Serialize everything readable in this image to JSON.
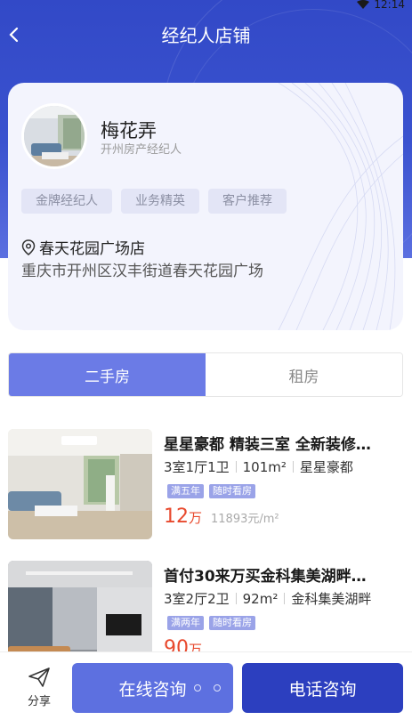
{
  "status_bar": {
    "time": "12:14"
  },
  "nav": {
    "title": "经纪人店铺"
  },
  "agent": {
    "name": "梅花弄",
    "title": "开州房产经纪人",
    "tags": [
      "金牌经纪人",
      "业务精英",
      "客户推荐"
    ],
    "store_name": "春天花园广场店",
    "store_address": "重庆市开州区汉丰街道春天花园广场"
  },
  "tabs": [
    {
      "label": "二手房",
      "active": true
    },
    {
      "label": "租房",
      "active": false
    }
  ],
  "listings": [
    {
      "title": "星星豪都 精装三室 全新装修…",
      "layout": "3室1厅1卫",
      "area": "101m²",
      "community": "星星豪都",
      "badges": [
        "满五年",
        "随时看房"
      ],
      "price": "12",
      "price_unit": "万",
      "unit_price": "11893元/m²"
    },
    {
      "title": "首付30来万买金科集美湖畔…",
      "layout": "3室2厅2卫",
      "area": "92m²",
      "community": "金科集美湖畔",
      "badges": [
        "满两年",
        "随时看房"
      ],
      "price": "90",
      "price_unit": "万",
      "unit_price": ""
    }
  ],
  "bottom_bar": {
    "share_label": "分享",
    "online_label": "在线咨询",
    "phone_label": "电话咨询"
  },
  "colors": {
    "header": "#3249c7",
    "accent": "#6b7be6",
    "price": "#e8492d",
    "phone_button": "#2c3fbf"
  }
}
